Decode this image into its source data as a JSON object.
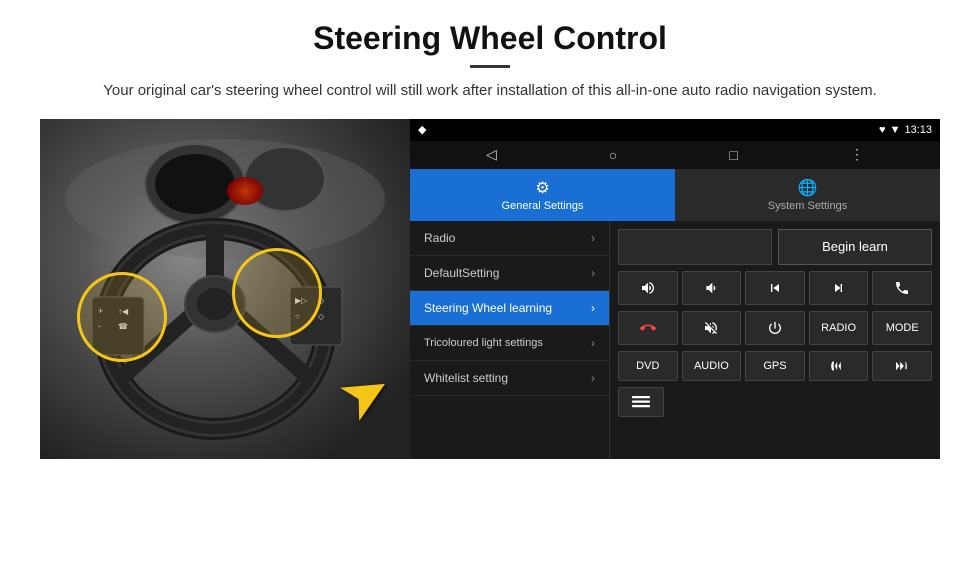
{
  "page": {
    "title": "Steering Wheel Control",
    "subtitle": "Your original car's steering wheel control will still work after installation of this all-in-one auto radio navigation system.",
    "divider_label": "——"
  },
  "status_bar": {
    "time": "13:13",
    "icons": "♥ ▼"
  },
  "nav_bar": {
    "back": "◁",
    "home": "○",
    "recents": "□",
    "menu": "⋮"
  },
  "tabs": [
    {
      "id": "general",
      "label": "General Settings",
      "active": true
    },
    {
      "id": "system",
      "label": "System Settings",
      "active": false
    }
  ],
  "menu_items": [
    {
      "id": "radio",
      "label": "Radio",
      "active": false
    },
    {
      "id": "default",
      "label": "DefaultSetting",
      "active": false
    },
    {
      "id": "steering",
      "label": "Steering Wheel learning",
      "active": true
    },
    {
      "id": "tricoloured",
      "label": "Tricoloured light settings",
      "active": false
    },
    {
      "id": "whitelist",
      "label": "Whitelist setting",
      "active": false
    }
  ],
  "buttons": {
    "begin_learn": "Begin learn",
    "row1": [
      "▶+",
      "◀-",
      "|◀◀",
      "▶▶|",
      "☎"
    ],
    "row2": [
      "↩",
      "🔇",
      "⏻",
      "RADIO",
      "MODE"
    ],
    "row3": [
      "DVD",
      "AUDIO",
      "GPS",
      "☎|◀◀",
      "◀▶|"
    ],
    "row4": [
      "⊟"
    ]
  }
}
